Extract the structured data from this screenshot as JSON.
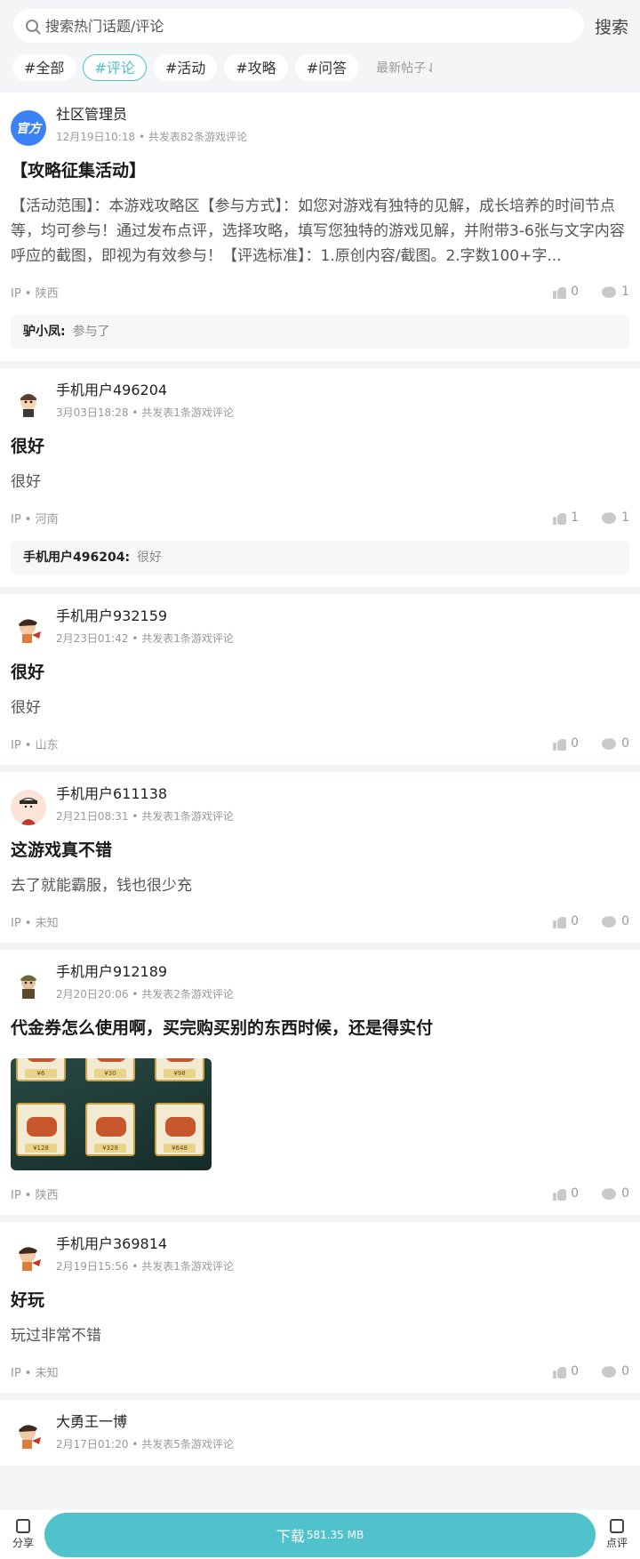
{
  "search": {
    "placeholder": "搜索热门话题/评论",
    "button": "搜索"
  },
  "tags": [
    "#全部",
    "#评论",
    "#活动",
    "#攻略",
    "#问答"
  ],
  "active_tag": 1,
  "sort_label": "最新帖子⇃",
  "posts": [
    {
      "avatar": "官方",
      "user": "社区管理员",
      "time": "12月19日10:18",
      "stats": "共发表82条游戏评论",
      "title": "【攻略征集活动】",
      "body": "【活动范围】：本游戏攻略区【参与方式】：如您对游戏有独特的见解，成长培养的时间节点等，均可参与！通过发布点评，选择攻略，填写您独特的游戏见解，并附带3-6张与文字内容呼应的截图，即视为有效参与！【评选标准】：1.原创内容/截图。2.字数100+字...",
      "ip": "IP • 陕西",
      "likes": "0",
      "comments": "1",
      "reply_user": "驴小凤:",
      "reply_text": "参与了"
    },
    {
      "user": "手机用户496204",
      "time": "3月03日18:28",
      "stats": "共发表1条游戏评论",
      "title": "很好",
      "body": "很好",
      "ip": "IP • 河南",
      "likes": "1",
      "comments": "1",
      "reply_user": "手机用户496204:",
      "reply_text": "很好"
    },
    {
      "user": "手机用户932159",
      "time": "2月23日01:42",
      "stats": "共发表1条游戏评论",
      "title": "很好",
      "body": "很好",
      "ip": "IP • 山东",
      "likes": "0",
      "comments": "0"
    },
    {
      "user": "手机用户611138",
      "time": "2月21日08:31",
      "stats": "共发表1条游戏评论",
      "title": "这游戏真不错",
      "body": "去了就能霸服，钱也很少充",
      "ip": "IP • 未知",
      "likes": "0",
      "comments": "0"
    },
    {
      "user": "手机用户912189",
      "time": "2月20日20:06",
      "stats": "共发表2条游戏评论",
      "title": "代金券怎么使用啊，买完购买别的东西时候，还是得实付",
      "ip": "IP • 陕西",
      "likes": "0",
      "comments": "0",
      "image_prices": [
        "¥6",
        "¥30",
        "¥98",
        "¥128",
        "¥328",
        "¥648"
      ]
    },
    {
      "user": "手机用户369814",
      "time": "2月19日15:56",
      "stats": "共发表1条游戏评论",
      "title": "好玩",
      "body": "玩过非常不错",
      "ip": "IP • 未知",
      "likes": "0",
      "comments": "0"
    },
    {
      "user": "大勇王一博",
      "time": "2月17日01:20",
      "stats": "共发表5条游戏评论"
    }
  ],
  "bottom": {
    "share": "分享",
    "download": "下载",
    "size": "581.35 MB",
    "review": "点评"
  },
  "colors": {
    "accent": "#4fc2cc",
    "official": "#3b82f6"
  }
}
